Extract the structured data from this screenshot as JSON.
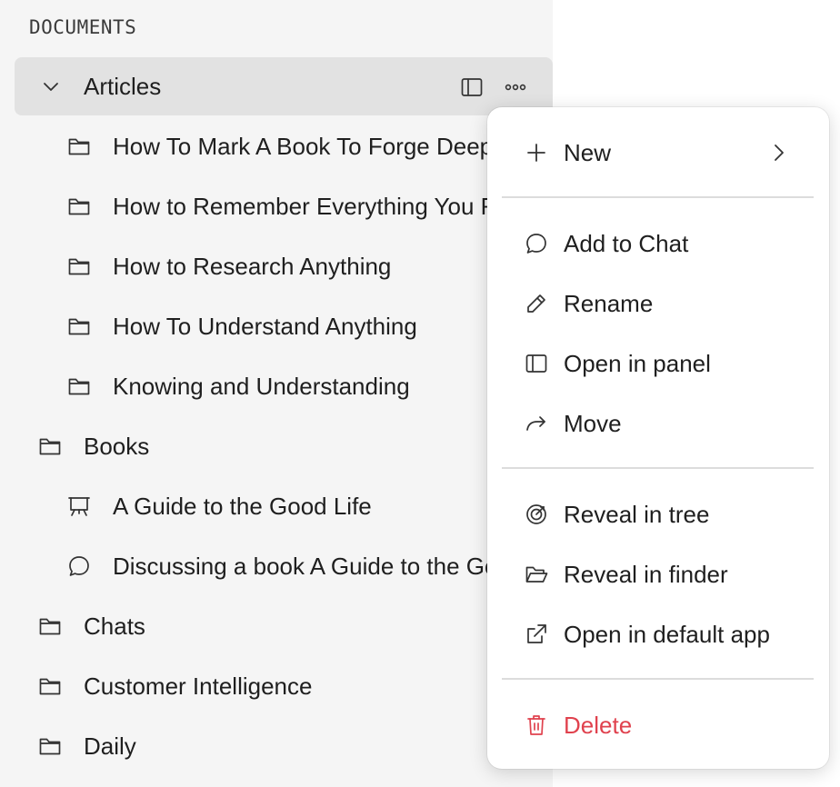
{
  "sidebar": {
    "section_title": "DOCUMENTS",
    "items": [
      {
        "label": "Articles",
        "icon": "chevron-down-icon",
        "level": 0,
        "selected": true
      },
      {
        "label": "How To Mark A Book To Forge Deep Understanding",
        "icon": "folder-icon",
        "level": 1
      },
      {
        "label": "How to Remember Everything You Read",
        "icon": "folder-icon",
        "level": 1
      },
      {
        "label": "How to Research Anything",
        "icon": "folder-icon",
        "level": 1
      },
      {
        "label": "How To Understand Anything",
        "icon": "folder-icon",
        "level": 1
      },
      {
        "label": "Knowing and Understanding",
        "icon": "folder-icon",
        "level": 1
      },
      {
        "label": "Books",
        "icon": "folder-icon",
        "level": 0
      },
      {
        "label": "A Guide to the Good Life",
        "icon": "presentation-icon",
        "level": 1
      },
      {
        "label": "Discussing a book A Guide to the Good Life",
        "icon": "chat-bubble-icon",
        "level": 1
      },
      {
        "label": "Chats",
        "icon": "folder-icon",
        "level": 0
      },
      {
        "label": "Customer Intelligence",
        "icon": "folder-icon",
        "level": 0
      },
      {
        "label": "Daily",
        "icon": "folder-icon",
        "level": 0
      }
    ],
    "row_actions": [
      "panel-icon",
      "more-icon"
    ]
  },
  "context_menu": {
    "items": [
      {
        "label": "New",
        "icon": "plus-icon",
        "has_submenu": true
      },
      {
        "label": "Add to Chat",
        "icon": "chat-bubble-icon"
      },
      {
        "label": "Rename",
        "icon": "pencil-icon"
      },
      {
        "label": "Open in panel",
        "icon": "panel-icon"
      },
      {
        "label": "Move",
        "icon": "move-arrow-icon"
      },
      {
        "label": "Reveal in tree",
        "icon": "target-icon"
      },
      {
        "label": "Reveal in finder",
        "icon": "folder-open-icon"
      },
      {
        "label": "Open in default app",
        "icon": "external-link-icon"
      },
      {
        "label": "Delete",
        "icon": "trash-icon",
        "danger": true
      }
    ]
  },
  "colors": {
    "sidebar_bg": "#f5f5f5",
    "selected_row": "#e2e2e2",
    "danger": "#e0424e",
    "text": "#1f1f1f"
  }
}
